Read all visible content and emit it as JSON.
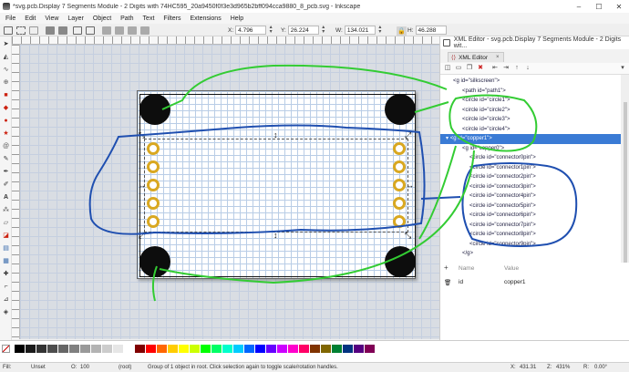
{
  "window": {
    "title": "*svg.pcb.Display 7 Segments Module - 2 Digits with 74HC595_20a9450f0f3e3d965b2bff094cca9880_8_pcb.svg - Inkscape",
    "minimize": "–",
    "maximize": "☐",
    "close": "✕"
  },
  "menu": [
    "File",
    "Edit",
    "View",
    "Layer",
    "Object",
    "Path",
    "Text",
    "Filters",
    "Extensions",
    "Help"
  ],
  "toolbar": {
    "x_label": "X:",
    "x_value": "4.796",
    "y_label": "Y:",
    "y_value": "26.224",
    "w_label": "W:",
    "w_value": "134.021",
    "h_label": "H:",
    "h_value": "46.288",
    "units": "mm",
    "lock_icon": "🔒"
  },
  "xml_editor": {
    "window_title": "XML Editor - svg.pcb.Display 7 Segments Module - 2 Digits wit...",
    "tab_label": "XML Editor",
    "tab_close": "×",
    "nodes": [
      {
        "text": "<g id=\"silkscreen\">",
        "indent": 1
      },
      {
        "text": "<path id=\"path1\">",
        "indent": 2
      },
      {
        "text": "<circle id=\"circle1\">",
        "indent": 2
      },
      {
        "text": "<circle id=\"circle2\">",
        "indent": 2
      },
      {
        "text": "<circle id=\"circle3\">",
        "indent": 2
      },
      {
        "text": "<circle id=\"circle4\">",
        "indent": 2
      },
      {
        "text": "<g id=\"copper1\">",
        "indent": 1,
        "selected": true
      },
      {
        "text": "<g id=\"copper0\">",
        "indent": 2
      },
      {
        "text": "<circle id=\"connector0pin\">",
        "indent": 3
      },
      {
        "text": "<circle id=\"connector1pin\">",
        "indent": 3
      },
      {
        "text": "<circle id=\"connector2pin\">",
        "indent": 3
      },
      {
        "text": "<circle id=\"connector3pin\">",
        "indent": 3
      },
      {
        "text": "<circle id=\"connector4pin\">",
        "indent": 3
      },
      {
        "text": "<circle id=\"connector5pin\">",
        "indent": 3
      },
      {
        "text": "<circle id=\"connector6pin\">",
        "indent": 3
      },
      {
        "text": "<circle id=\"connector7pin\">",
        "indent": 3
      },
      {
        "text": "<circle id=\"connector8pin\">",
        "indent": 3
      },
      {
        "text": "<circle id=\"connector9pin\">",
        "indent": 3
      },
      {
        "text": "</g>",
        "indent": 2
      }
    ],
    "attr_header_name": "Name",
    "attr_header_value": "Value",
    "attr_add": "+",
    "attr_name": "id",
    "attr_value": "copper1",
    "attr_delete": "🗑"
  },
  "palette": {
    "swatches": [
      "#000000",
      "#1a1a1a",
      "#333333",
      "#4d4d4d",
      "#666666",
      "#808080",
      "#999999",
      "#b3b3b3",
      "#cccccc",
      "#e6e6e6",
      "#ffffff",
      "#800000",
      "#ff0000",
      "#ff6600",
      "#ffcc00",
      "#ffff00",
      "#ccff00",
      "#00ff00",
      "#00ff66",
      "#00ffcc",
      "#00ccff",
      "#0066ff",
      "#0000ff",
      "#6600ff",
      "#cc00ff",
      "#ff00cc",
      "#ff0066",
      "#803300",
      "#806600",
      "#008033",
      "#003380",
      "#550080",
      "#800055"
    ]
  },
  "status": {
    "fill_label": "Fill:",
    "stroke_label": "Stroke:",
    "fill_value": "Unset",
    "opacity_label": "O:",
    "opacity_value": "100",
    "layer": "(root)",
    "message": "Group of 1 object in root. Click selection again to toggle scale/rotation handles.",
    "x_label": "X:",
    "x_value": "431.31",
    "y_label": "Y:",
    "y_value": "26.72",
    "zoom_label": "Z:",
    "zoom_value": "431%",
    "rotation_label": "R:",
    "rotation_value": "0.00°"
  },
  "colors": {
    "accent": "#3a7bd5",
    "copper": "#d9a821",
    "annotation_blue": "#1f4fb0",
    "annotation_green": "#33cc33"
  }
}
